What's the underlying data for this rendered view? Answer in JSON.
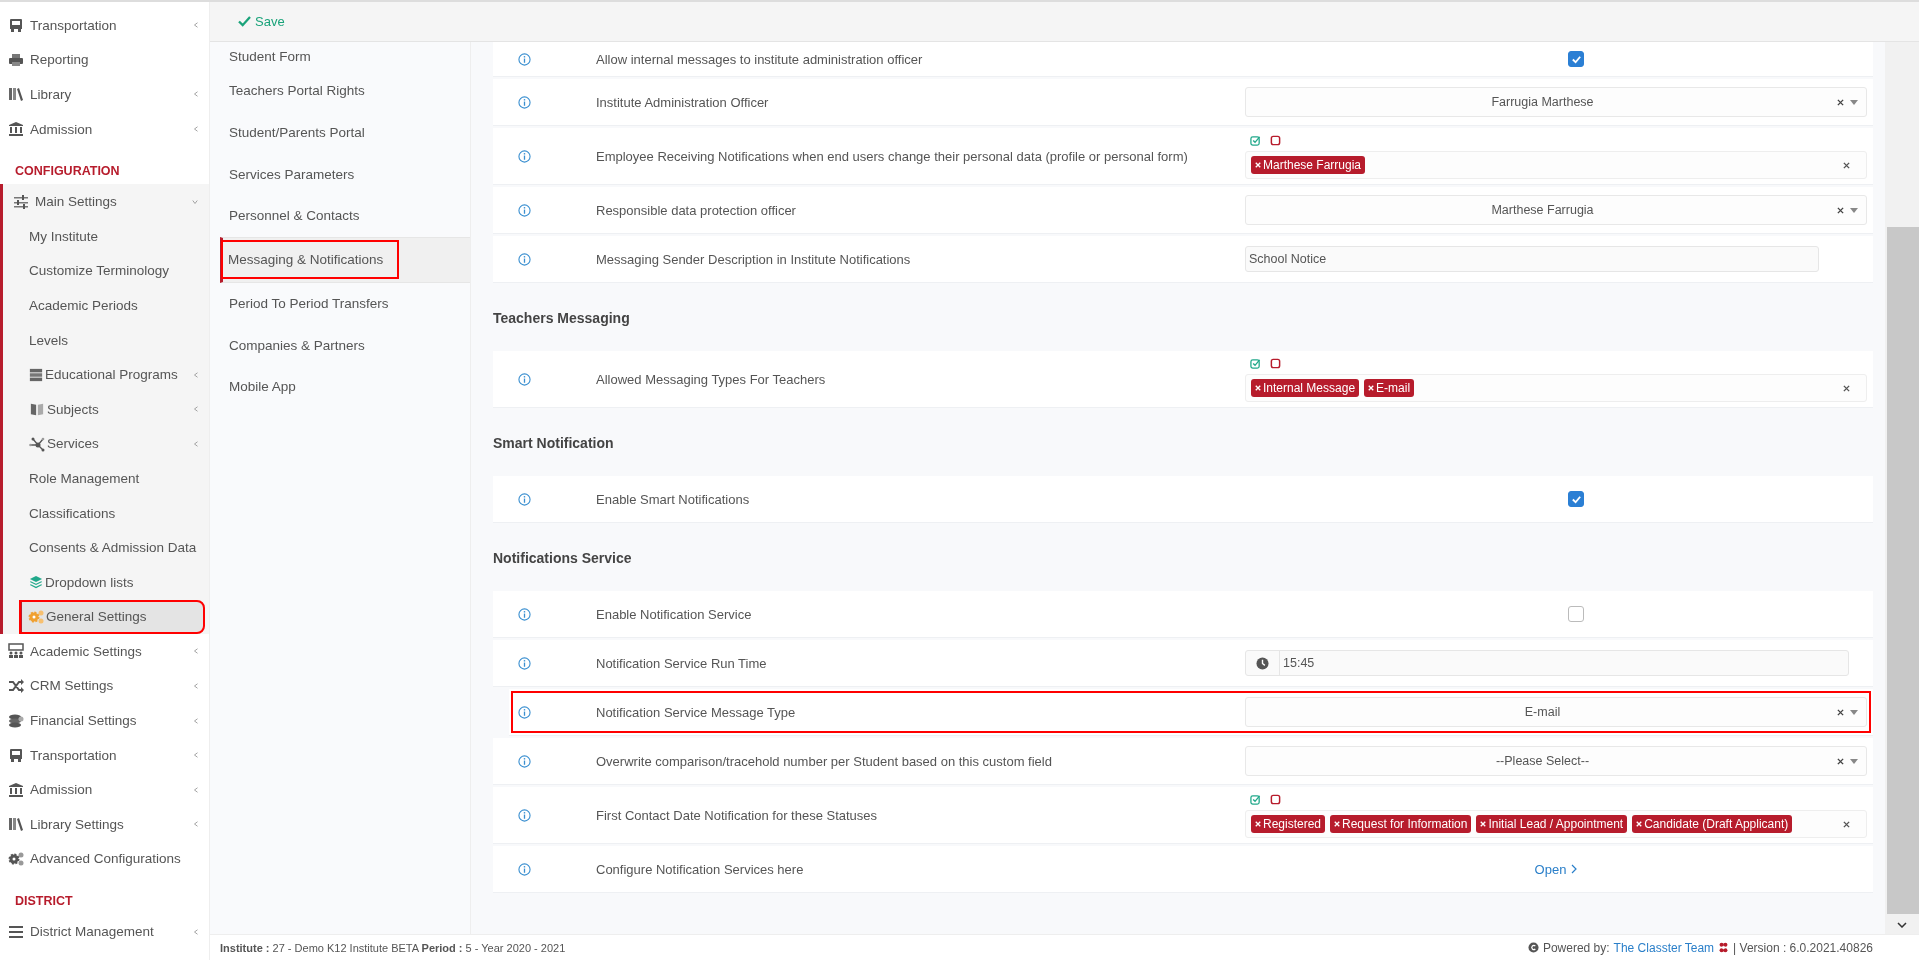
{
  "toolbar": {
    "save_label": "Save"
  },
  "sidebar": {
    "items": [
      {
        "kind": "item",
        "label": "Transportation",
        "has_submenu": true
      },
      {
        "kind": "item",
        "label": "Reporting",
        "has_submenu": false
      },
      {
        "kind": "item",
        "label": "Library",
        "has_submenu": true
      },
      {
        "kind": "item",
        "label": "Admission",
        "has_submenu": true
      },
      {
        "kind": "heading",
        "label": "CONFIGURATION"
      },
      {
        "kind": "group",
        "label": "Main Settings",
        "expanded": true,
        "children": [
          {
            "label": "My Institute",
            "has_submenu": false,
            "selected": false,
            "highlighted": false
          },
          {
            "label": "Customize Terminology",
            "has_submenu": false,
            "selected": false,
            "highlighted": false
          },
          {
            "label": "Academic Periods",
            "has_submenu": false,
            "selected": false,
            "highlighted": false
          },
          {
            "label": "Levels",
            "has_submenu": false,
            "selected": false,
            "highlighted": false
          },
          {
            "label": "Educational Programs",
            "has_submenu": true,
            "selected": false,
            "highlighted": false
          },
          {
            "label": "Subjects",
            "has_submenu": true,
            "selected": false,
            "highlighted": false
          },
          {
            "label": "Services",
            "has_submenu": true,
            "selected": false,
            "highlighted": false
          },
          {
            "label": "Role Management",
            "has_submenu": false,
            "selected": false,
            "highlighted": false
          },
          {
            "label": "Classifications",
            "has_submenu": false,
            "selected": false,
            "highlighted": false
          },
          {
            "label": "Consents & Admission Data",
            "has_submenu": false,
            "selected": false,
            "highlighted": false
          },
          {
            "label": "Dropdown lists",
            "has_submenu": false,
            "selected": false,
            "highlighted": false
          },
          {
            "label": "General Settings",
            "has_submenu": false,
            "selected": true,
            "highlighted": true
          }
        ]
      },
      {
        "kind": "item",
        "label": "Academic Settings",
        "has_submenu": true
      },
      {
        "kind": "item",
        "label": "CRM Settings",
        "has_submenu": true
      },
      {
        "kind": "item",
        "label": "Financial Settings",
        "has_submenu": true
      },
      {
        "kind": "item",
        "label": "Transportation",
        "has_submenu": true
      },
      {
        "kind": "item",
        "label": "Admission",
        "has_submenu": true
      },
      {
        "kind": "item",
        "label": "Library Settings",
        "has_submenu": true
      },
      {
        "kind": "item",
        "label": "Advanced Configurations",
        "has_submenu": false
      },
      {
        "kind": "heading",
        "label": "DISTRICT"
      },
      {
        "kind": "item",
        "label": "District Management",
        "has_submenu": true
      }
    ]
  },
  "submenu": {
    "items": [
      {
        "label": "Student Form",
        "selected": false,
        "highlighted": false
      },
      {
        "label": "Teachers Portal Rights",
        "selected": false,
        "highlighted": false
      },
      {
        "label": "Student/Parents Portal",
        "selected": false,
        "highlighted": false
      },
      {
        "label": "Services Parameters",
        "selected": false,
        "highlighted": false
      },
      {
        "label": "Personnel & Contacts",
        "selected": false,
        "highlighted": false
      },
      {
        "label": "Messaging & Notifications",
        "selected": true,
        "highlighted": true
      },
      {
        "label": "Period To Period Transfers",
        "selected": false,
        "highlighted": false
      },
      {
        "label": "Companies & Partners",
        "selected": false,
        "highlighted": false
      },
      {
        "label": "Mobile App",
        "selected": false,
        "highlighted": false
      }
    ]
  },
  "settings": [
    {
      "kind": "row",
      "label": "Allow internal messages to institute administration officer",
      "highlighted": false,
      "control": {
        "kind": "checkbox",
        "checked": true
      }
    },
    {
      "kind": "row",
      "label": "Institute Administration Officer",
      "highlighted": false,
      "control": {
        "kind": "select",
        "value": "Farrugia Marthese"
      }
    },
    {
      "kind": "row",
      "label": "Employee Receiving Notifications when end users change their personal data (profile or personal form)",
      "highlighted": false,
      "control": {
        "kind": "tags",
        "tags": [
          "Marthese Farrugia"
        ]
      }
    },
    {
      "kind": "row",
      "label": "Responsible data protection officer",
      "highlighted": false,
      "control": {
        "kind": "select",
        "value": "Marthese Farrugia"
      }
    },
    {
      "kind": "row",
      "label": "Messaging Sender Description in Institute Notifications",
      "highlighted": false,
      "control": {
        "kind": "text",
        "value": "School Notice"
      }
    },
    {
      "kind": "heading",
      "label": "Teachers Messaging"
    },
    {
      "kind": "row",
      "label": "Allowed Messaging Types For Teachers",
      "highlighted": false,
      "control": {
        "kind": "tags",
        "tags": [
          "Internal Message",
          "E-mail"
        ]
      }
    },
    {
      "kind": "heading",
      "label": "Smart Notification"
    },
    {
      "kind": "row",
      "label": "Enable Smart Notifications",
      "highlighted": false,
      "control": {
        "kind": "checkbox",
        "checked": true
      }
    },
    {
      "kind": "heading",
      "label": "Notifications Service"
    },
    {
      "kind": "row",
      "label": "Enable Notification Service",
      "highlighted": false,
      "control": {
        "kind": "checkbox",
        "checked": false
      }
    },
    {
      "kind": "row",
      "label": "Notification Service Run Time",
      "highlighted": false,
      "control": {
        "kind": "time",
        "value": "15:45"
      }
    },
    {
      "kind": "row",
      "label": "Notification Service Message Type",
      "highlighted": true,
      "control": {
        "kind": "select",
        "value": "E-mail"
      }
    },
    {
      "kind": "row",
      "label": "Overwrite comparison/tracehold number per Student based on this custom field",
      "highlighted": false,
      "control": {
        "kind": "select",
        "value": "--Please Select--"
      }
    },
    {
      "kind": "row",
      "label": "First Contact Date Notification for these Statuses",
      "highlighted": false,
      "control": {
        "kind": "tags",
        "tags": [
          "Registered",
          "Request for Information",
          "Initial Lead / Appointment",
          "Candidate (Draft Applicant)"
        ]
      }
    },
    {
      "kind": "row",
      "label": "Configure Notification Services here",
      "highlighted": false,
      "control": {
        "kind": "link",
        "label": "Open"
      }
    }
  ],
  "footer": {
    "institute": "**Institute :** 27 - Demo K12 Institute BETA **Period :** 5 - Year 2020 - 2021",
    "powered_by": "Powered by:",
    "team_link": "The Classter Team",
    "version": "| Version : 6.0.2021.40826"
  }
}
